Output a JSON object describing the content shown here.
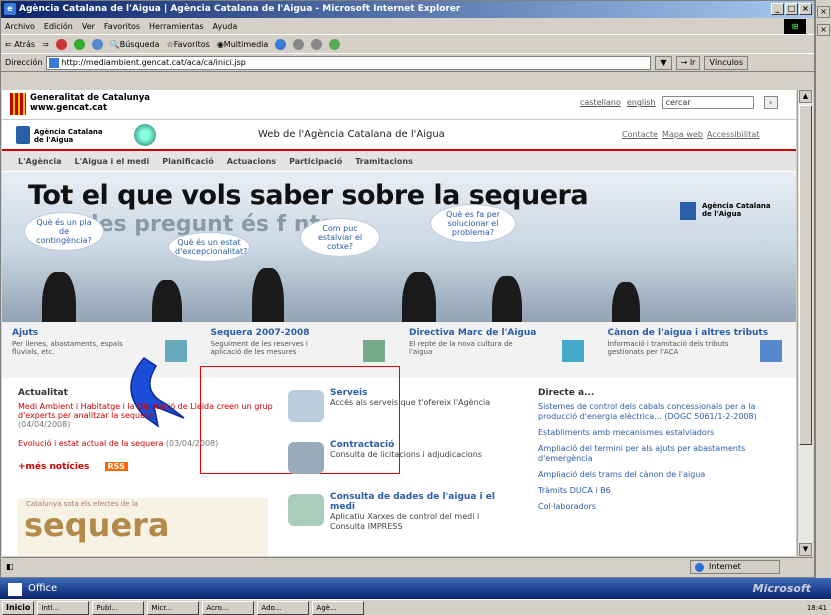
{
  "window": {
    "title": "Agència Catalana de l'Aigua | Agència Catalana de l'Aigua - Microsoft Internet Explorer"
  },
  "menu": [
    "Archivo",
    "Edición",
    "Ver",
    "Favoritos",
    "Herramientas",
    "Ayuda"
  ],
  "toolbar": [
    "Atrás",
    "Búsqueda",
    "Favoritos",
    "Multimedia"
  ],
  "address": {
    "label": "Dirección",
    "url": "http://mediambient.gencat.cat/aca/ca/inici.jsp",
    "go": "Ir",
    "links": "Vínculos"
  },
  "gencat": {
    "name": "Generalitat de Catalunya",
    "url": "www.gencat.cat",
    "lang1": "castellano",
    "lang2": "english",
    "search_placeholder": "cercar"
  },
  "aca": {
    "name_line1": "Agència Catalana",
    "name_line2": "de l'Aigua",
    "web": "Web de l'Agència Catalana de l'Aigua",
    "links": [
      "Contacte",
      "Mapa web",
      "Accessibilitat"
    ]
  },
  "nav": [
    "L'Agència",
    "L'Aigua i el medi",
    "Planificació",
    "Actuacions",
    "Participació",
    "Tramitacions"
  ],
  "banner": {
    "headline": "Tot el que vols saber sobre la sequera",
    "sub": "ta les pregunt    és f    nts",
    "bubbles": [
      "Què és un pla de contingència?",
      "Què és un estat d'excepcionalitat?",
      "Com puc estalviar el cotxe?",
      "Què es fa per solucionar el problema?"
    ],
    "aca_line1": "Agència Catalana",
    "aca_line2": "de l'Aigua"
  },
  "cards": [
    {
      "title": "Ajuts",
      "desc": "Per llenes, abastaments, espais fluvials, etc."
    },
    {
      "title": "Sequera 2007-2008",
      "desc": "Seguiment de les reserves i aplicació de les mesures"
    },
    {
      "title": "Directiva Marc de l'Aigua",
      "desc": "El repte de la nova cultura de l'aigua"
    },
    {
      "title": "Cànon de l'aigua i altres tributs",
      "desc": "Informació i tramitació dels tributs gestionats per l'ACA"
    }
  ],
  "actualitat": {
    "heading": "Actualitat",
    "news1": "Medi Ambient i Habitatge i la Diputació de Lleida creen un grup d'experts per analitzar la sequera",
    "date1": "(04/04/2008)",
    "news2": "Evolució i estat actual de la sequera",
    "date2": "(03/04/2008)",
    "more": "+més notícies",
    "rss": "RSS",
    "promo_line": "Catalunya sota els efectes de la",
    "promo_word": "sequera"
  },
  "services": [
    {
      "title": "Serveis",
      "desc": "Accés als serveis que t'ofereix l'Agència"
    },
    {
      "title": "Contractació",
      "desc": "Consulta de licitacions i adjudicacions"
    },
    {
      "title": "Consulta de dades de l'aigua i el medi",
      "desc": "Aplicatiu Xarxes de control del medi i Consulta IMPRESS"
    }
  ],
  "directe": {
    "heading": "Directe a...",
    "items": [
      "Sistemes de control dels cabals concessionals per a la producció d'energia elèctrica... (DOGC 5061/1-2-2008)",
      "Establiments amb mecanismes estalviadors",
      "Ampliació del termini per als ajuts per abastaments d'emergència",
      "Ampliació dels trams del cànon de l'aigua",
      "Tràmits DUCA i B6",
      "Col·laboradors"
    ]
  },
  "status": {
    "zone": "Internet"
  },
  "office": {
    "label": "Office",
    "brand": "Microsoft"
  },
  "taskbar": {
    "start": "Inicio",
    "tasks": [
      "Intl...",
      "Publ...",
      "Micr...",
      "Acro...",
      "Ado...",
      "Agè..."
    ],
    "clock": "18:41"
  }
}
